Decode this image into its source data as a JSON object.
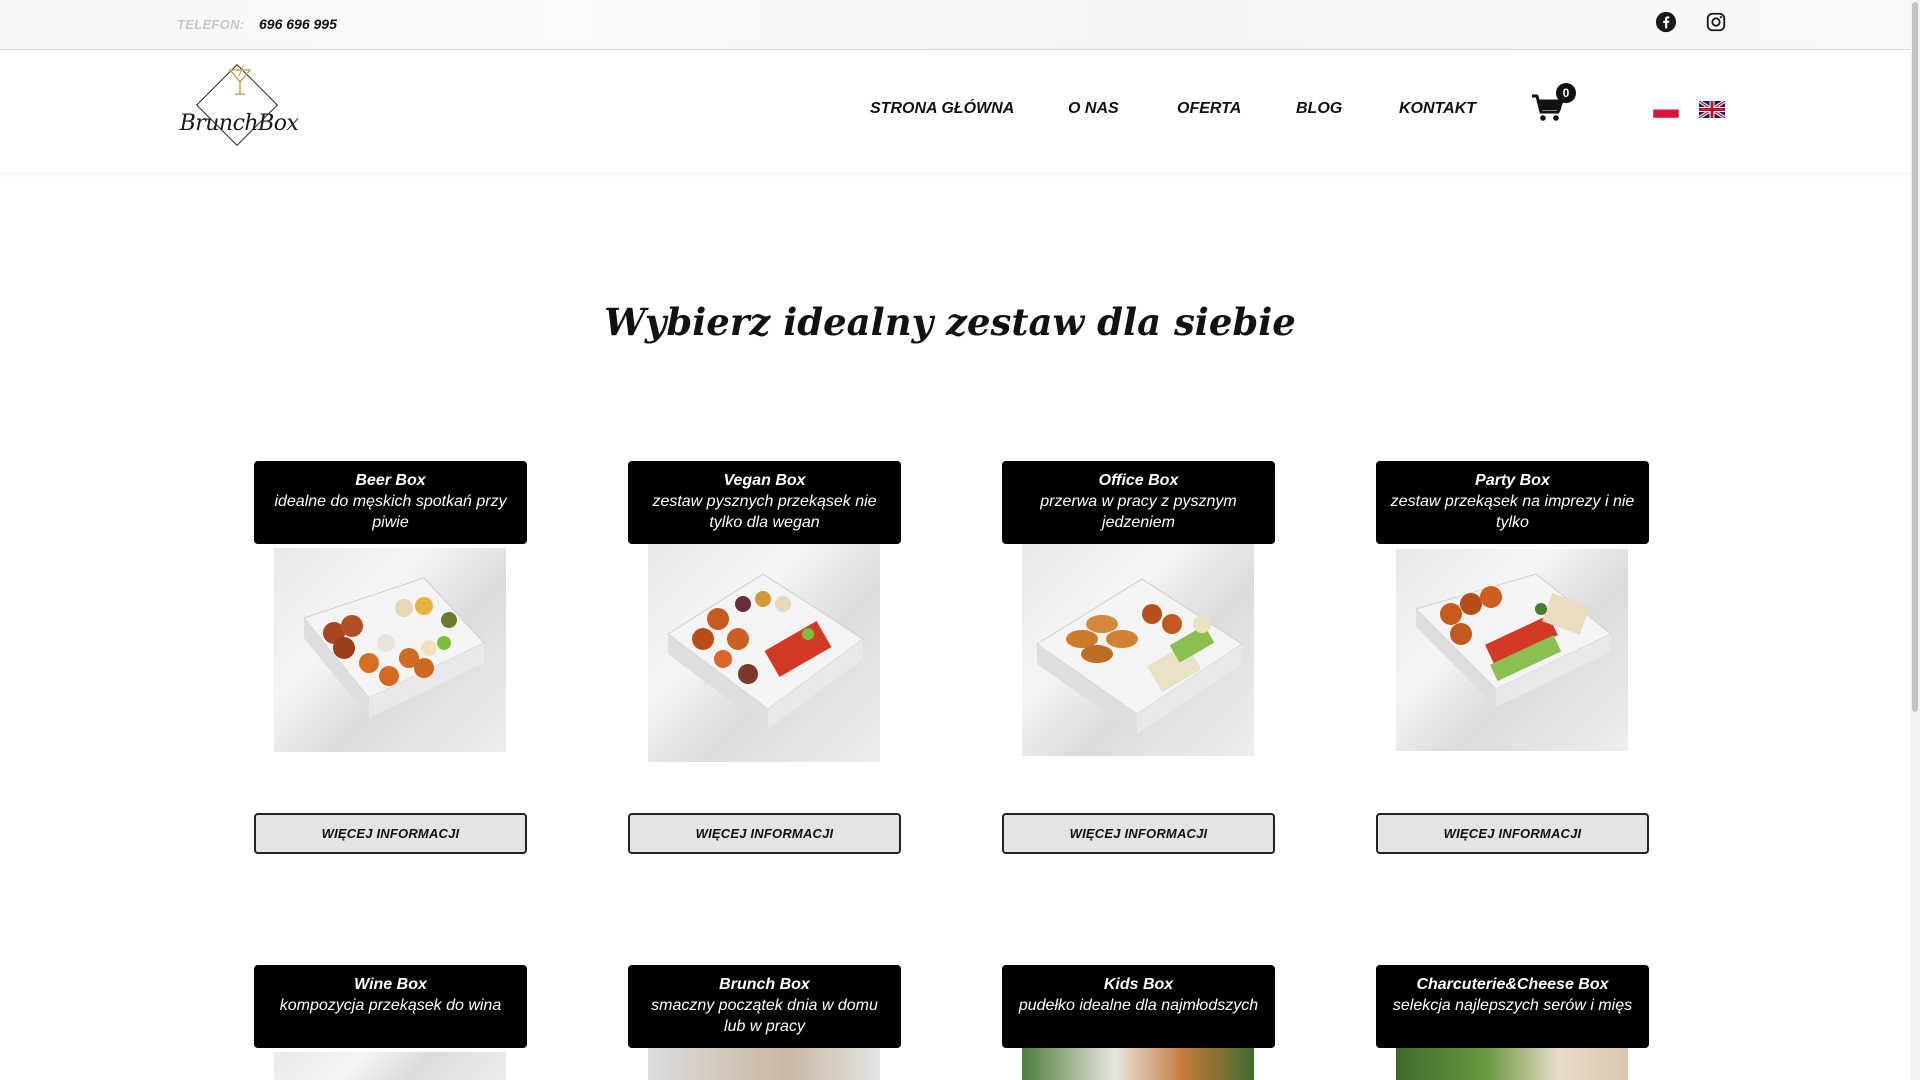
{
  "topbar": {
    "phone_label": "TELEFON:",
    "phone_number": "696 696 995",
    "social": [
      "facebook-icon",
      "instagram-icon"
    ]
  },
  "header": {
    "logo_text": "BrunchBox",
    "nav": [
      "STRONA GŁÓWNA",
      "O NAS",
      "OFERTA",
      "BLOG",
      "KONTAKT"
    ],
    "cart_count": "0",
    "languages": [
      "pl-flag-icon",
      "en-flag-icon"
    ]
  },
  "main": {
    "title": "Wybierz idealny zestaw dla siebie",
    "cards": [
      {
        "title": "Beer Box",
        "subtitle": "idealne do męskich spotkań przy piwie",
        "button": "WIĘCEJ INFORMACJI"
      },
      {
        "title": "Vegan Box",
        "subtitle": "zestaw pysznych przekąsek nie tylko dla wegan",
        "button": "WIĘCEJ INFORMACJI"
      },
      {
        "title": "Office Box",
        "subtitle": "przerwa w pracy z pysznym jedzeniem",
        "button": "WIĘCEJ INFORMACJI"
      },
      {
        "title": "Party Box",
        "subtitle": "zestaw przekąsek na imprezy i nie tylko",
        "button": "WIĘCEJ INFORMACJI"
      },
      {
        "title": "Wine Box",
        "subtitle": "kompozycja przekąsek do wina"
      },
      {
        "title": "Brunch Box",
        "subtitle": "smaczny początek dnia w domu lub w pracy"
      },
      {
        "title": "Kids Box",
        "subtitle": "pudełko idealne dla najmłodszych"
      },
      {
        "title": "Charcuterie&Cheese Box",
        "subtitle": "selekcja najlepszych serów i mięs"
      }
    ]
  },
  "colors": {
    "accent": "#000000",
    "button_bg": "#e4e4e4",
    "logo_gold": "#c9a35a"
  }
}
